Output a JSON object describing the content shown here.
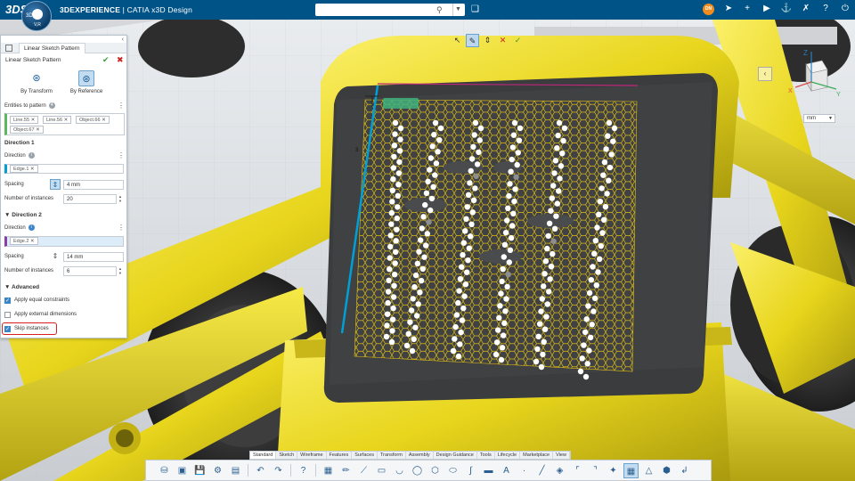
{
  "topbar": {
    "logo": "3DS",
    "compass_top": "3D",
    "compass_bottom": "V,R",
    "brand": "3DEXPERIENCE",
    "app_name": "CATIA",
    "app_module": "x3D Design",
    "search_placeholder": "",
    "user_initials": "DN",
    "icons": [
      "tag-icon",
      "share-icon",
      "plus-icon",
      "play-icon",
      "network-icon",
      "tools-icon",
      "help-icon",
      "power-icon"
    ]
  },
  "context_toolbar": {
    "icons": [
      "cursor-icon",
      "sketch-select-icon",
      "spacing-icon",
      "delete-icon",
      "validate-icon"
    ]
  },
  "panel": {
    "tab_label": "Linear Sketch Pattern",
    "title": "Linear Sketch Pattern",
    "modes": [
      {
        "label": "By Transform",
        "selected": false
      },
      {
        "label": "By Reference",
        "selected": true
      }
    ],
    "entities_label": "Entities to pattern",
    "entities_count": "4",
    "entities": [
      "Line.55",
      "Line.56",
      "Object.66",
      "Object.67"
    ],
    "direction1": {
      "header": "Direction 1",
      "direction_label": "Direction",
      "direction_info": "i",
      "direction_value": "Edge.1",
      "spacing_label": "Spacing",
      "spacing_value": "4 mm",
      "instances_label": "Number of instances",
      "instances_value": "20"
    },
    "direction2": {
      "header": "Direction 2",
      "direction_label": "Direction",
      "direction_info": "i",
      "direction_value": "Edge.2",
      "spacing_label": "Spacing",
      "spacing_value": "14 mm",
      "instances_label": "Number of instances",
      "instances_value": "6"
    },
    "advanced": {
      "header": "Advanced",
      "options": [
        {
          "label": "Apply equal constraints",
          "checked": true
        },
        {
          "label": "Apply external dimensions",
          "checked": false
        },
        {
          "label": "Skip instances",
          "checked": true
        }
      ]
    }
  },
  "viewport": {
    "unit": "mm",
    "annotation_number": "3",
    "axis_labels": {
      "z": "Z",
      "x": "X",
      "y": "Y"
    }
  },
  "bottom_tabs": [
    "Standard",
    "Sketch",
    "Wireframe",
    "Features",
    "Surfaces",
    "Transform",
    "Assembly",
    "Design Guidance",
    "Tools",
    "Lifecycle",
    "Marketplace",
    "View"
  ],
  "active_tab": "Standard",
  "colors": {
    "topbar": "#005387",
    "yellow": "#f2e33a",
    "pattern": "#e8c21a",
    "direction1": "#00a0d6",
    "direction2": "#8a3fa8"
  }
}
